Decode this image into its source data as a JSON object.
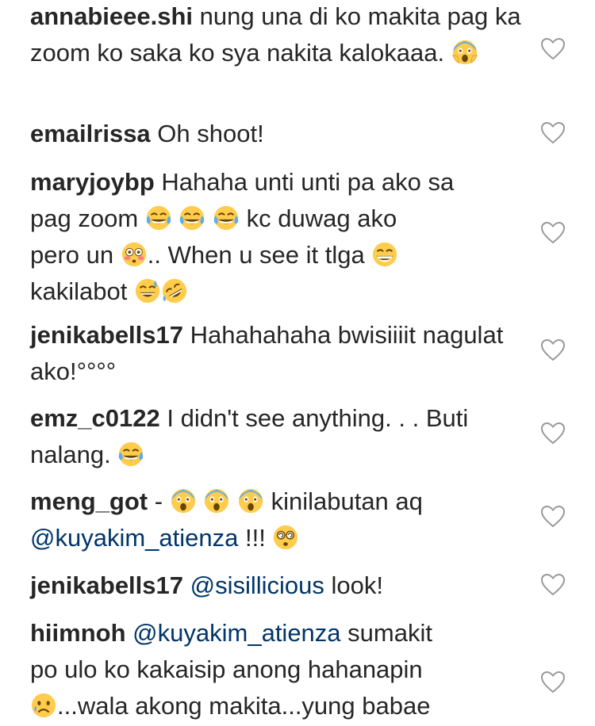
{
  "comments": [
    {
      "user": "annabieee.shi",
      "parts": [
        "nung una di ko makita pag ka zoom ko saka ko sya nakita kalokaaa. "
      ],
      "emoji_after": [
        "screaming-face"
      ]
    },
    {
      "user": "emailrissa",
      "parts": [
        "Oh shoot!"
      ]
    },
    {
      "user": "maryjoybp",
      "line1": "Hahaha unti unti pa ako sa",
      "line2_pre": "pag zoom",
      "line2_post": "kc duwag ako",
      "line3_pre": "pero un",
      "line3_post": ".. When u see it tlga",
      "line4": "kakilabot"
    },
    {
      "user": "jenikabells17",
      "text": "Hahahahaha bwisiiiit nagulat ako!°°°°"
    },
    {
      "user": "emz_c0122",
      "text": "I didn't see anything. . . Buti nalang."
    },
    {
      "user": "meng_got",
      "pre": "-",
      "post": "kinilabutan aq",
      "mention": "@kuyakim_atienza",
      "tail": "!!!"
    },
    {
      "user": "jenikabells17",
      "mention": "@sisillicious",
      "tail": "look!"
    },
    {
      "user": "hiimnoh",
      "mention": "@kuyakim_atienza",
      "line1_post": "sumakit",
      "line2": "po ulo ko kakaisip anong hahanapin",
      "line3": "...wala akong makita...yung babae"
    }
  ],
  "icons": {
    "like": "heart-outline-icon"
  }
}
